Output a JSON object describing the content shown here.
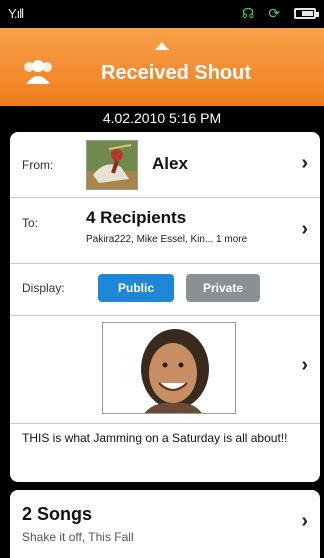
{
  "status_bar": {
    "signal": "Y.ıll"
  },
  "header": {
    "title": "Received Shout"
  },
  "timestamp": "4.02.2010 5:16 PM",
  "from": {
    "label": "From:",
    "name": "Alex"
  },
  "to": {
    "label": "To:",
    "count": "4 Recipients",
    "names": "Pakira222, Mike Essel, Kin... 1 more"
  },
  "display": {
    "label": "Display:",
    "public": "Public",
    "private": "Private",
    "selected": "Public"
  },
  "caption": "THIS is what Jamming on a Saturday is all about!!",
  "songs": {
    "title": "2 Songs",
    "subtitle": "Shake it off, This Fall"
  },
  "colors": {
    "accent": "#f08a2a",
    "public_button": "#1f86d8",
    "private_button": "#8a9094"
  }
}
